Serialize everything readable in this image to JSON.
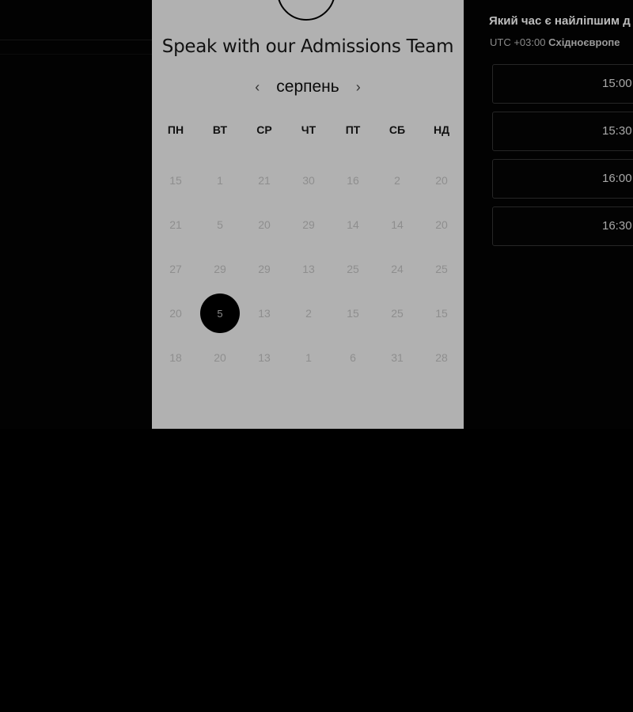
{
  "calendar": {
    "title": "Speak with our Admissions Team",
    "month": "серпень",
    "prev_icon": "chevron-left-icon",
    "next_icon": "chevron-right-icon",
    "weekdays": [
      "ПН",
      "ВТ",
      "СР",
      "ЧТ",
      "ПТ",
      "СБ",
      "НД"
    ],
    "days": [
      [
        "15",
        "1",
        "21",
        "30",
        "16",
        "2",
        "20"
      ],
      [
        "21",
        "5",
        "20",
        "29",
        "14",
        "14",
        "20"
      ],
      [
        "27",
        "29",
        "29",
        "13",
        "25",
        "24",
        "25"
      ],
      [
        "20",
        "5",
        "13",
        "2",
        "15",
        "25",
        "15"
      ],
      [
        "18",
        "20",
        "13",
        "1",
        "6",
        "31",
        "28"
      ]
    ],
    "selected": {
      "row": 3,
      "col": 1
    }
  },
  "times": {
    "question": "Який час є найліпшим д",
    "timezone_offset": "UTC +03:00",
    "timezone_name": "Східноєвропе",
    "slots": [
      "15:00",
      "15:30",
      "16:00",
      "16:30"
    ]
  }
}
